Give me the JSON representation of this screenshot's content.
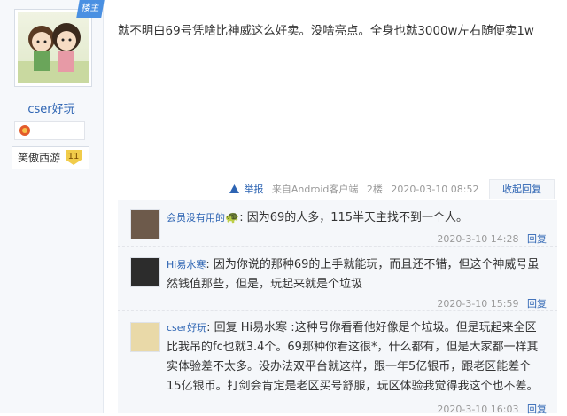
{
  "author": {
    "badge": "楼主",
    "username": "cser好玩",
    "game_name": "笑傲西游",
    "game_level": "11"
  },
  "post": {
    "content": "就不明白69号凭啥比神威这么好卖。没啥亮点。全身也就3000w左右随便卖1w",
    "report_label": "举报",
    "source": "来自Android客户端",
    "floor": "2楼",
    "time": "2020-03-10 08:52",
    "collapse_label": "收起回复"
  },
  "replies": [
    {
      "name": "会员没有用的",
      "text": ": 因为69的人多，115半天主找不到一个人。",
      "time": "2020-3-10 14:28",
      "reply_label": "回复"
    },
    {
      "name": "Hi易水寒",
      "text": ": 因为你说的那种69的上手就能玩，而且还不错，但这个神威号虽然钱值那些，但是，玩起来就是个垃圾",
      "time": "2020-3-10 15:59",
      "reply_label": "回复"
    },
    {
      "name": "cser好玩",
      "text": ": 回复 Hi易水寒 :这种号你看看他好像是个垃圾。但是玩起来全区比我吊的fc也就3.4个。69那种你看这很*，什么都有，但是大家都一样其实体验差不太多。没办法双平台就这样，跟一年5亿银币，跟老区能差个15亿银币。打剑会肯定是老区买号舒服，玩区体验我觉得我这个也不差。",
      "time": "2020-3-10 16:03",
      "reply_label": "回复"
    }
  ]
}
